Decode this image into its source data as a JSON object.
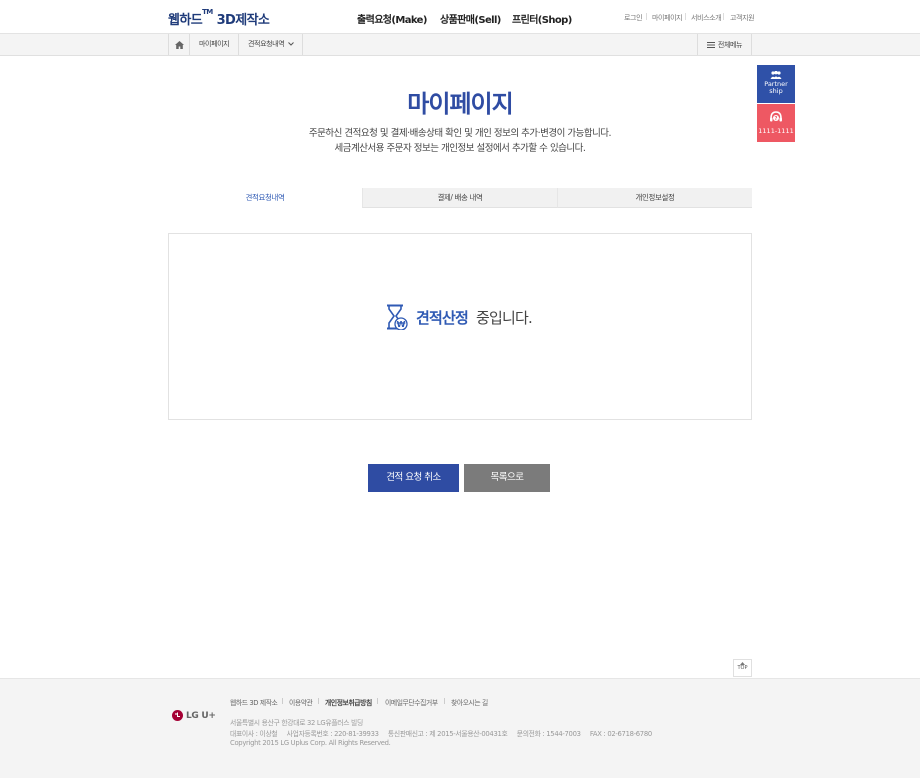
{
  "header": {
    "logo_main": "웹하드",
    "logo_tm": "TM",
    "logo_sub": "3D제작소",
    "nav": [
      "출력요청(Make)",
      "상품판매(Sell)",
      "프린터(Shop)"
    ],
    "util": [
      "로그인",
      "마이페이지",
      "서비스소개",
      "고객지원"
    ]
  },
  "location": {
    "home_icon": "home-icon",
    "items": [
      "마이페이지",
      "견적요청내역"
    ],
    "all_menu": "전체메뉴"
  },
  "quick": {
    "partner_line1": "Partner",
    "partner_line2": "ship",
    "phone": "1111-1111"
  },
  "page": {
    "title": "마이페이지",
    "desc1": "주문하신 견적요청 및 결제·배송상태 확인 및 개인 정보의 추가·변경이 가능합니다.",
    "desc2": "세금계산서용 주문자 정보는 개인정보 설정에서 추가할 수 있습니다."
  },
  "tabs": [
    {
      "label": "견적요청내역",
      "active": true
    },
    {
      "label": "결제/ 배송 내역",
      "active": false
    },
    {
      "label": "개인정보설정",
      "active": false
    }
  ],
  "status": {
    "icon": "hourglass-won-icon",
    "strong": "견적산정",
    "rest": "중입니다."
  },
  "buttons": {
    "cancel": "견적 요청 취소",
    "list": "목록으로"
  },
  "top_button": "TOP",
  "footer": {
    "logo": "LG U+",
    "links": [
      "웹하드 3D 제작소",
      "이용약관",
      "개인정보취급방침",
      "이메일무단수집거부",
      "찾아오시는 길"
    ],
    "address": "서울특별시 용산구 한강대로 32 LG유플러스 빌딩",
    "info": "대표이사 : 이상철     사업자등록번호 : 220-81-39933     통신판매신고 : 제 2015-서울용산-00431호     문의전화 : 1544-7003     FAX : 02-6718-6780",
    "copyright": "Copyright 2015 LG Uplus Corp. All Rights Reserved."
  },
  "colors": {
    "brand_blue": "#2f4ca3",
    "tab_active": "#2f5ab4",
    "partner_bg": "#2f51a8",
    "call_bg": "#ee5863",
    "list_btn": "#7b7b7b"
  }
}
